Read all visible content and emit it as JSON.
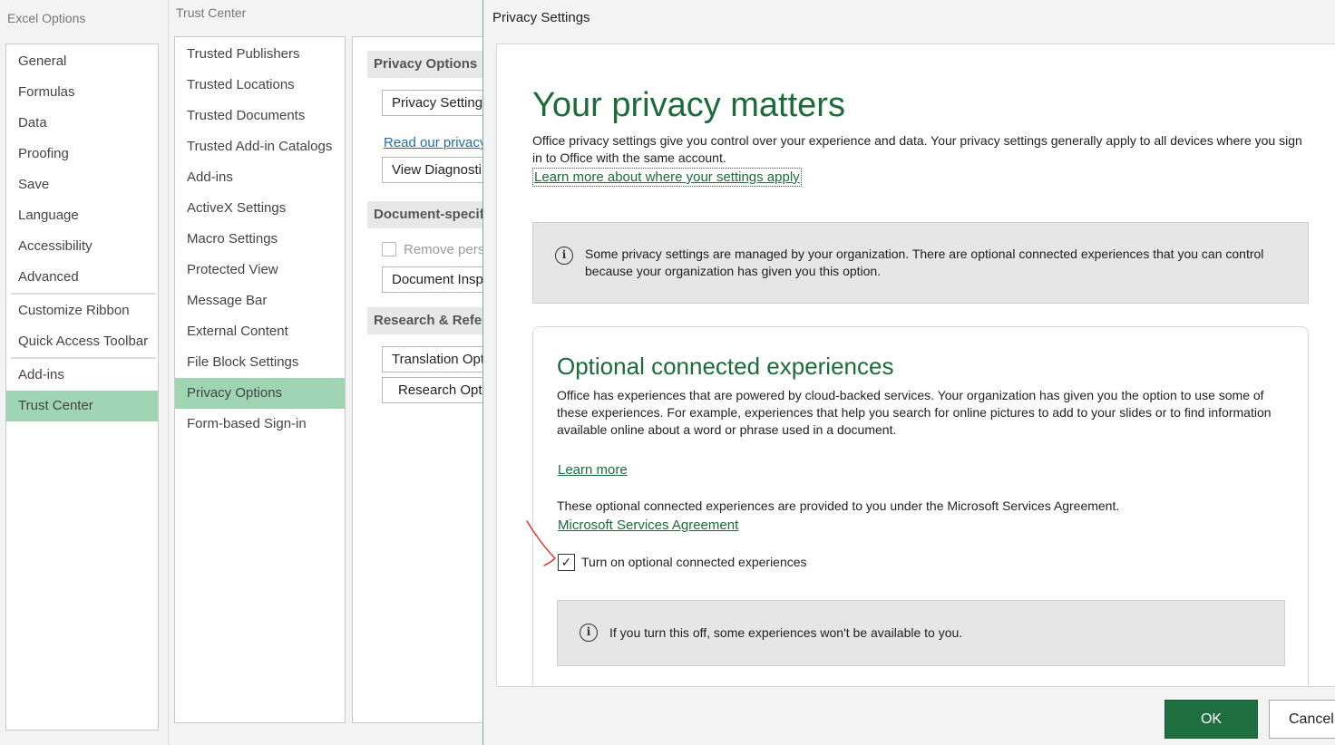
{
  "excel_options": {
    "title": "Excel Options",
    "nav": [
      "General",
      "Formulas",
      "Data",
      "Proofing",
      "Save",
      "Language",
      "Accessibility",
      "Advanced",
      "Customize Ribbon",
      "Quick Access Toolbar",
      "Add-ins",
      "Trust Center"
    ],
    "selected": "Trust Center"
  },
  "trust_center": {
    "title": "Trust Center",
    "nav": [
      "Trusted Publishers",
      "Trusted Locations",
      "Trusted Documents",
      "Trusted Add-in Catalogs",
      "Add-ins",
      "ActiveX Settings",
      "Macro Settings",
      "Protected View",
      "Message Bar",
      "External Content",
      "File Block Settings",
      "Privacy Options",
      "Form-based Sign-in"
    ],
    "selected": "Privacy Options",
    "content": {
      "privacy_options_header": "Privacy Options",
      "privacy_settings_button": "Privacy Settings",
      "read_privacy_link": "Read our privacy",
      "view_diagnostic_button": "View Diagnosti",
      "document_specific_header": "Document-specif",
      "remove_personal_label": "Remove pers",
      "document_inspector_button": "Document Insp",
      "research_header": "Research & Refer",
      "translation_button": "Translation Opt",
      "research_button": "Research Opti"
    }
  },
  "privacy_dialog": {
    "title": "Privacy Settings",
    "heading": "Your privacy matters",
    "intro": "Office privacy settings give you control over your experience and data. Your privacy settings generally apply to all devices where you sign in to Office with the same account.",
    "learn_where_link": "Learn more about where your settings apply",
    "org_notice": "Some privacy settings are managed by your organization. There are optional connected experiences that you can control because your organization has given you this option.",
    "oce": {
      "heading": "Optional connected experiences",
      "description": "Office has experiences that are powered by cloud-backed services. Your organization has given you the option to use some of these experiences. For example, experiences that help you search for online pictures to add to your slides or to find information available online about a word or phrase used in a document.",
      "learn_more_link": "Learn more",
      "msa_text": "These optional connected experiences are provided to you under the Microsoft Services Agreement.",
      "msa_link": "Microsoft Services Agreement",
      "checkbox_label": "Turn on optional connected experiences",
      "checkbox_mark": "✓",
      "warning": "If you turn this off, some experiences won't be available to you."
    },
    "ok_label": "OK",
    "cancel_label": "Cancel"
  },
  "colors": {
    "accent_green": "#1c6b3a",
    "ok_button": "#1f6e3f",
    "selected_nav": "#9fd5b2",
    "annotation_red": "#e02020"
  },
  "icons": {
    "info": "info-circle-icon",
    "checkmark": "checkmark-icon"
  }
}
